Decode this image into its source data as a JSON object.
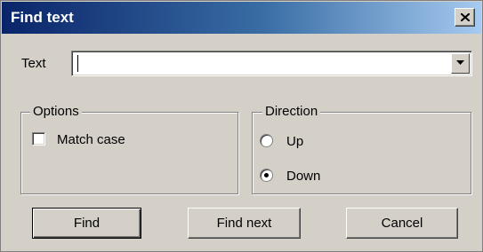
{
  "window": {
    "title": "Find text",
    "close_icon": "close-icon",
    "titlebar_color": "#0a246a",
    "face_color": "#d4d0c8"
  },
  "search": {
    "label": "Text",
    "value": "",
    "dropdown_icon": "chevron-down-icon"
  },
  "options": {
    "title": "Options",
    "match_case": {
      "label": "Match case",
      "checked": false
    }
  },
  "direction": {
    "title": "Direction",
    "up": {
      "label": "Up",
      "selected": false
    },
    "down": {
      "label": "Down",
      "selected": true
    }
  },
  "buttons": {
    "find": "Find",
    "find_next": "Find next",
    "cancel": "Cancel"
  }
}
